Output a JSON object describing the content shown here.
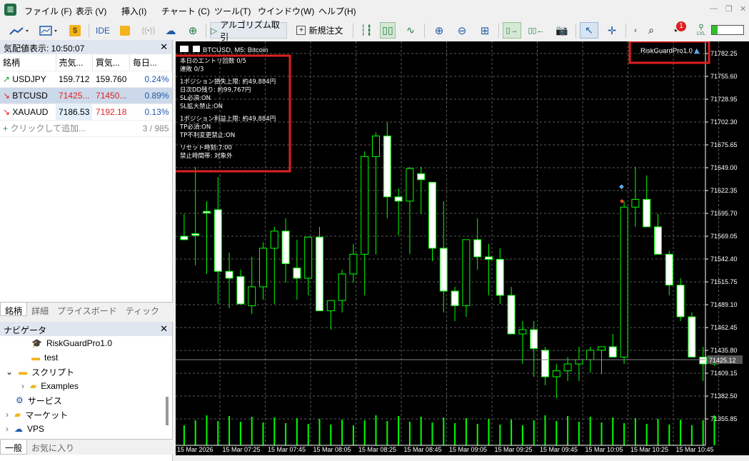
{
  "menu": [
    "ファイル (F)",
    "表示 (V)",
    "挿入(I)",
    "チャート (C)",
    "ツール(T)",
    "ウインドウ(W)",
    "ヘルプ(H)"
  ],
  "toolbar": {
    "ide_label": "IDE",
    "algo_label": "アルゴリズム取引",
    "new_order_label": "新規注文",
    "notification_count": "1",
    "level_label": "LVL"
  },
  "market_watch": {
    "title": "気配値表示: 10:50:07",
    "columns": [
      "銘柄",
      "売気...",
      "買気...",
      "毎日..."
    ],
    "rows": [
      {
        "symbol": "USDJPY",
        "bid": "159.712",
        "ask": "159.760",
        "change": "0.24%",
        "dir": "up"
      },
      {
        "symbol": "BTCUSD",
        "bid": "71425...",
        "ask": "71450...",
        "change": "0.89%",
        "dir": "down"
      },
      {
        "symbol": "XAUAUD",
        "bid": "7186.53",
        "ask": "7192.18",
        "change": "0.13%",
        "dir": "down"
      }
    ],
    "add_label": "クリックして追加...",
    "count": "3 / 985",
    "tabs": [
      "銘柄",
      "詳細",
      "プライスボード",
      "ティック"
    ]
  },
  "navigator": {
    "title": "ナビゲータ",
    "items": [
      "RiskGuardPro1.0",
      "test",
      "スクリプト",
      "Examples",
      "サービス",
      "マーケット",
      "VPS"
    ],
    "tabs": [
      "一般",
      "お気に入り"
    ]
  },
  "chart": {
    "header": "BTCUSD, M5: Bitcoin",
    "ea_label": "RiskGuardPro1.0",
    "current_price": "71425.12",
    "info_block": [
      "本日のエントリ回数 0/5",
      "連敗 0/3",
      "",
      "1ポジション損失上限: 約49,884円",
      "日次DD残り: 約99,767円",
      "SL必須:ON",
      "SL拡大禁止:ON",
      "",
      "1ポジション利益上限: 約49,884円",
      "TP必須:ON",
      "TP不利変更禁止:ON",
      "",
      "リセット時刻:7:00",
      "禁止時間帯: 対象外"
    ],
    "price_ticks": [
      "71782.25",
      "71755.60",
      "71728.95",
      "71702.30",
      "71675.65",
      "71649.00",
      "71622.35",
      "71595.70",
      "71569.05",
      "71542.40",
      "71515.75",
      "71489.10",
      "71462.45",
      "71435.80",
      "71409.15",
      "71382.50",
      "71355.85"
    ],
    "time_ticks": [
      "15 Mar 2026",
      "15 Mar 07:25",
      "15 Mar 07:45",
      "15 Mar 08:05",
      "15 Mar 08:25",
      "15 Mar 08:45",
      "15 Mar 09:05",
      "15 Mar 09:25",
      "15 Mar 09:45",
      "15 Mar 10:05",
      "15 Mar 10:25",
      "15 Mar 10:45"
    ],
    "colors": {
      "bg": "#000000",
      "bull": "#000000",
      "bear": "#ffffff",
      "wick": "#00ff00",
      "grid": "#5a5a5a"
    },
    "candles": [
      [
        71569,
        71595,
        71569,
        71565
      ],
      [
        71572,
        71650,
        71535,
        71570
      ],
      [
        71598,
        71610,
        71525,
        71596
      ],
      [
        71600,
        71638,
        71490,
        71528
      ],
      [
        71528,
        71550,
        71485,
        71520
      ],
      [
        71522,
        71530,
        71498,
        71490
      ],
      [
        71488,
        71545,
        71478,
        71510
      ],
      [
        71510,
        71562,
        71495,
        71555
      ],
      [
        71555,
        71580,
        71490,
        71575
      ],
      [
        71575,
        71590,
        71515,
        71537
      ],
      [
        71532,
        71565,
        71495,
        71520
      ],
      [
        71520,
        71548,
        71500,
        71568
      ],
      [
        71568,
        71580,
        71495,
        71482
      ],
      [
        71482,
        71490,
        71460,
        71494
      ],
      [
        71494,
        71530,
        71480,
        71525
      ],
      [
        71525,
        71560,
        71515,
        71548
      ],
      [
        71548,
        71668,
        71500,
        71662
      ],
      [
        71662,
        71690,
        71548,
        71686
      ],
      [
        71686,
        71702,
        71590,
        71615
      ],
      [
        71615,
        71625,
        71570,
        71610
      ],
      [
        71610,
        71650,
        71548,
        71648
      ],
      [
        71642,
        71650,
        71595,
        71635
      ],
      [
        71632,
        71632,
        71540,
        71555
      ],
      [
        71555,
        71610,
        71480,
        71505
      ],
      [
        71505,
        71510,
        71470,
        71488
      ],
      [
        71488,
        71555,
        71475,
        71565
      ],
      [
        71565,
        71590,
        71530,
        71545
      ],
      [
        71545,
        71560,
        71500,
        71542
      ],
      [
        71542,
        71555,
        71490,
        71500
      ],
      [
        71500,
        71510,
        71460,
        71455
      ],
      [
        71455,
        71470,
        71420,
        71460
      ],
      [
        71460,
        71470,
        71405,
        71438
      ],
      [
        71436,
        71440,
        71395,
        71405
      ],
      [
        71405,
        71420,
        71380,
        71412
      ],
      [
        71412,
        71428,
        71400,
        71420
      ],
      [
        71420,
        71440,
        71400,
        71425
      ],
      [
        71425,
        71440,
        71410,
        71436
      ],
      [
        71436,
        71440,
        71408,
        71440
      ],
      [
        71440,
        71455,
        71430,
        71428
      ],
      [
        71428,
        71610,
        71420,
        71603
      ],
      [
        71603,
        71650,
        71580,
        71612
      ],
      [
        71612,
        71640,
        71580,
        71580
      ],
      [
        71580,
        71595,
        71555,
        71548
      ],
      [
        71548,
        71552,
        71500,
        71512
      ],
      [
        71512,
        71520,
        71470,
        71475
      ],
      [
        71475,
        71480,
        71430,
        71428
      ],
      [
        71428,
        71440,
        71400,
        71420
      ],
      [
        71420,
        71425,
        71418,
        71425
      ]
    ]
  }
}
